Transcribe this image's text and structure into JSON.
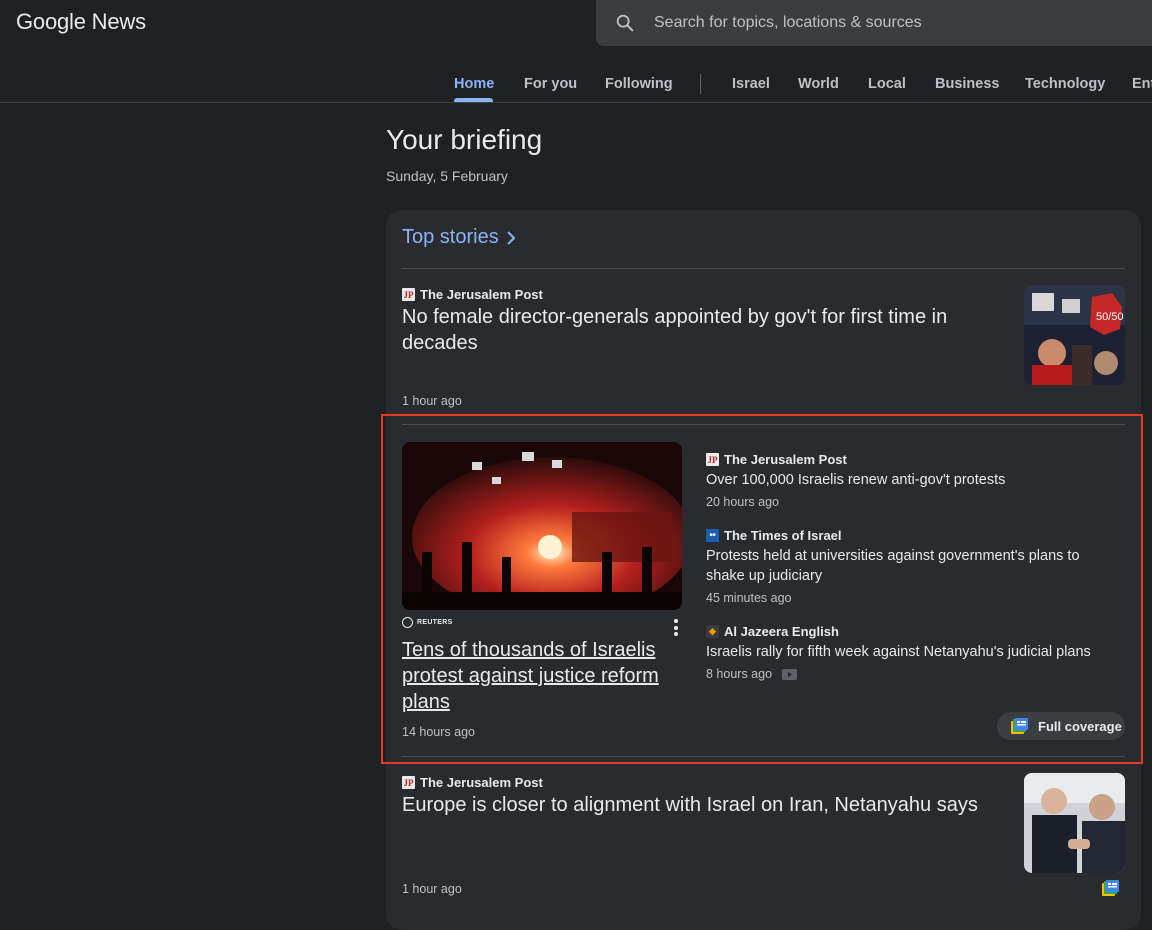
{
  "header": {
    "logo_text": "Google News",
    "search_placeholder": "Search for topics, locations & sources"
  },
  "nav": {
    "tabs": [
      {
        "label": "Home",
        "active": true
      },
      {
        "label": "For you"
      },
      {
        "label": "Following"
      },
      {
        "label": "Israel"
      },
      {
        "label": "World"
      },
      {
        "label": "Local"
      },
      {
        "label": "Business"
      },
      {
        "label": "Technology"
      },
      {
        "label": "Ent"
      }
    ]
  },
  "page": {
    "title": "Your briefing",
    "date": "Sunday, 5 February"
  },
  "top_stories": {
    "heading": "Top stories",
    "story1": {
      "source": "The Jerusalem Post",
      "headline": "No female director-generals appointed by gov't for first time in decades",
      "time": "1 hour ago"
    },
    "cluster": {
      "main_source": "REUTERS",
      "main_headline": "Tens of thousands of Israelis protest against justice reform plans",
      "main_time": "14 hours ago",
      "related": [
        {
          "source": "The Jerusalem Post",
          "headline": "Over 100,000 Israelis renew anti-gov't protests",
          "time": "20 hours ago"
        },
        {
          "source": "The Times of Israel",
          "headline": "Protests held at universities against government's plans to shake up judiciary",
          "time": "45 minutes ago"
        },
        {
          "source": "Al Jazeera English",
          "headline": "Israelis rally for fifth week against Netanyahu's judicial plans",
          "time": "8 hours ago"
        }
      ],
      "full_coverage_label": "Full coverage"
    },
    "story3": {
      "source": "The Jerusalem Post",
      "headline": "Europe is closer to alignment with Israel on Iran, Netanyahu says",
      "time": "1 hour ago"
    }
  },
  "colors": {
    "accent": "#8ab4f8",
    "background": "#202124",
    "card": "#2a2b2f",
    "highlight_border": "#e53a25"
  }
}
